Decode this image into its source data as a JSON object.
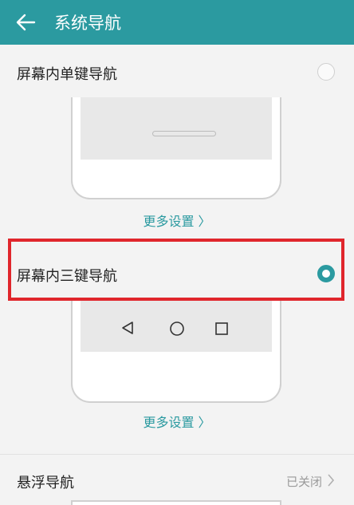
{
  "header": {
    "title": "系统导航",
    "back_icon": "arrow-left-icon"
  },
  "options": [
    {
      "label": "屏幕内单键导航",
      "selected": false,
      "more_settings": "更多设置 〉"
    },
    {
      "label": "屏幕内三键导航",
      "selected": true,
      "more_settings": "更多设置 〉"
    },
    {
      "label": "悬浮导航",
      "status": "已关闭"
    }
  ],
  "colors": {
    "accent": "#2b9aa0",
    "highlight": "#e0262c"
  },
  "nav_icons": [
    "back-triangle-icon",
    "home-circle-icon",
    "recent-square-icon"
  ]
}
